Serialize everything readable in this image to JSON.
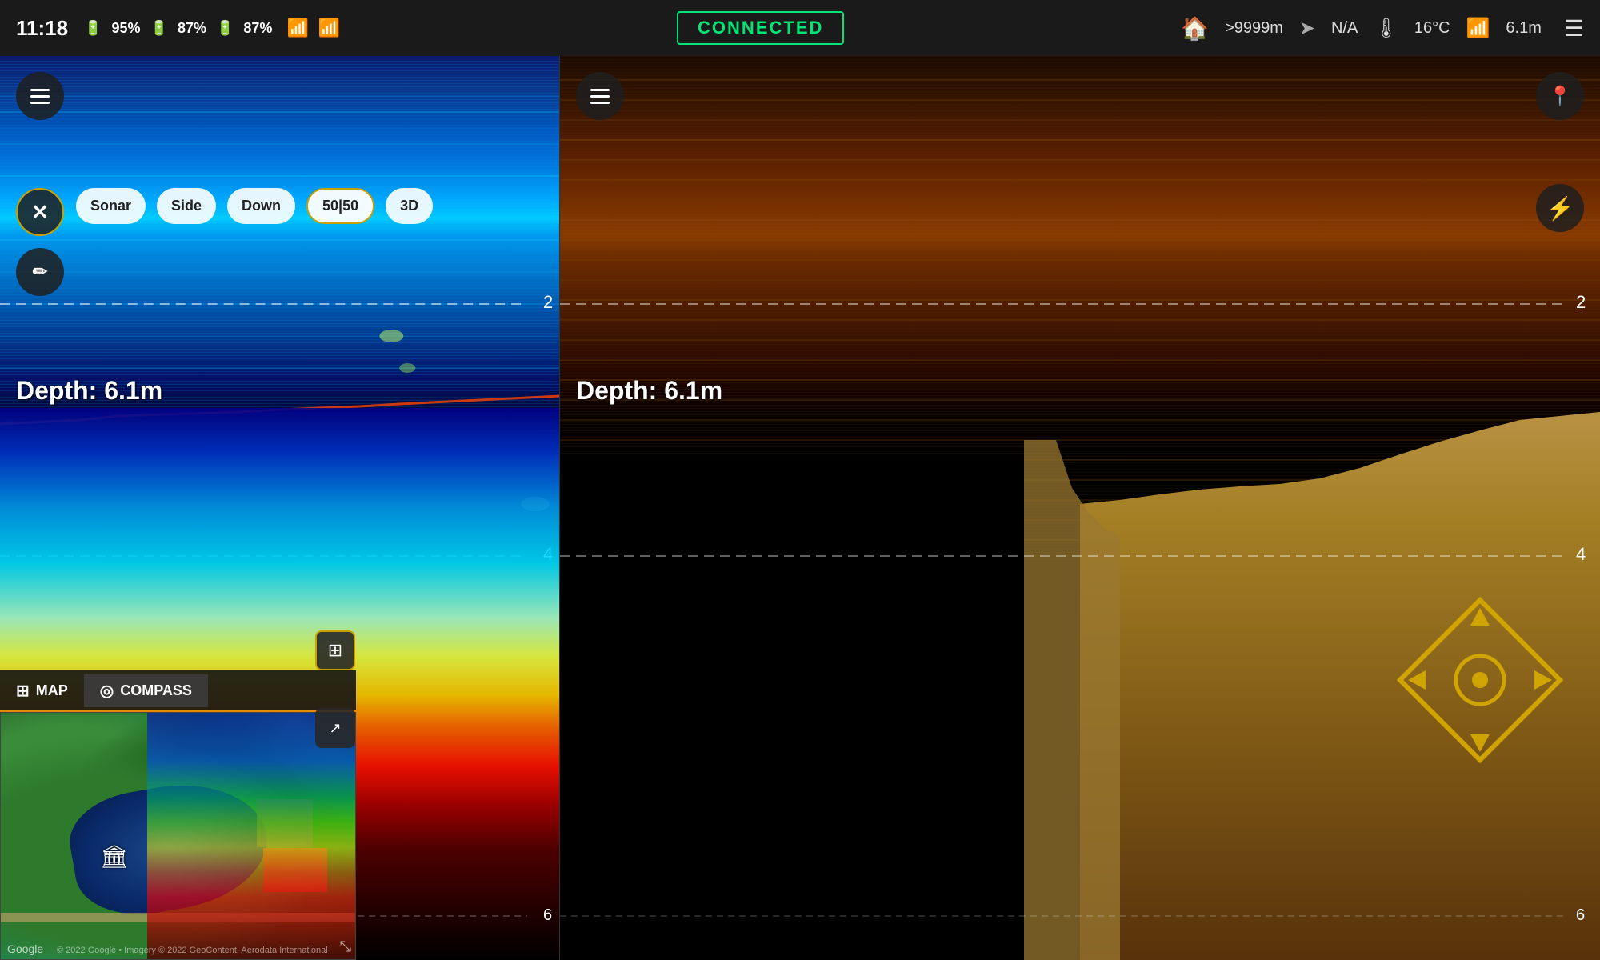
{
  "status_bar": {
    "time": "11:18",
    "battery1_pct": "95%",
    "battery2_pct": "87%",
    "battery3_pct": "87%",
    "connected_label": "CONNECTED",
    "home_distance": ">9999m",
    "heading": "N/A",
    "temperature": "16°C",
    "altitude": "6.1m"
  },
  "left_panel": {
    "depth_label": "Depth:  6.1m",
    "depth_value": "6.1m",
    "close_btn_label": "×",
    "mode_buttons": [
      {
        "label": "Sonar",
        "active": false
      },
      {
        "label": "Side",
        "active": false
      },
      {
        "label": "Down",
        "active": false
      },
      {
        "label": "50|50",
        "active": true
      },
      {
        "label": "3D",
        "active": false
      }
    ],
    "depth_marks": [
      {
        "value": "2",
        "position": 0.27
      },
      {
        "value": "4",
        "position": 0.55
      },
      {
        "value": "6",
        "position": 0.95
      }
    ]
  },
  "right_panel": {
    "depth_label": "Depth:  6.1m",
    "depth_value": "6.1m",
    "depth_marks": [
      {
        "value": "2",
        "position": 0.27
      },
      {
        "value": "4",
        "position": 0.55
      },
      {
        "value": "6",
        "position": 0.95
      }
    ]
  },
  "map_overlay": {
    "map_btn_label": "MAP",
    "compass_btn_label": "COMPASS",
    "expand_icon": "⊞",
    "external_icon": "↗",
    "collapse_icon": "⤡",
    "google_label": "Google",
    "copyright_text": "© 2022 Google • Imagery © 2022 GeoContent, Aerodata International",
    "drone_icon": "🏛"
  },
  "icons": {
    "menu": "☰",
    "close": "✕",
    "edit": "✏",
    "pin": "📍",
    "lightning": "⚡",
    "home": "🏠",
    "navigation": "➤",
    "thermometer": "🌡",
    "signal": "📶",
    "map_icon": "⊞",
    "compass_icon": "◎"
  }
}
